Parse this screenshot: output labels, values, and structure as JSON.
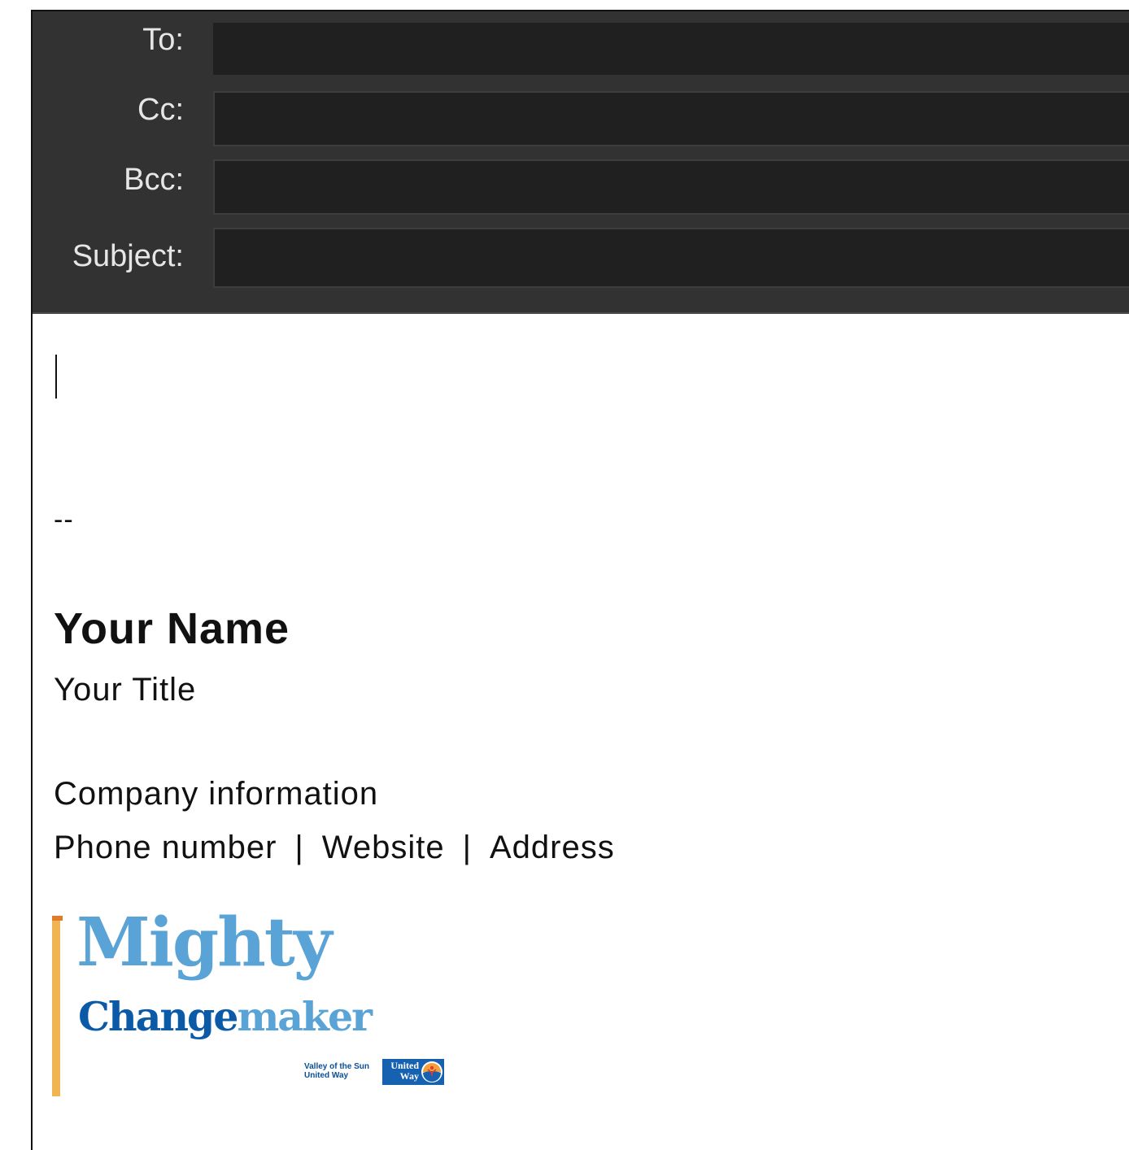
{
  "header": {
    "fields": [
      {
        "label": "To:",
        "value": ""
      },
      {
        "label": "Cc:",
        "value": ""
      },
      {
        "label": "Bcc:",
        "value": ""
      },
      {
        "label": "Subject:",
        "value": ""
      }
    ]
  },
  "body": {
    "separator": "--",
    "signature": {
      "name": "Your Name",
      "title": "Your Title",
      "company": "Company information",
      "contact": [
        "Phone number",
        "Website",
        "Address"
      ],
      "divider": "|"
    }
  },
  "logo": {
    "line1": "Mighty",
    "line2_dark": "Change",
    "line2_light": "maker",
    "org_line1": "Valley of the Sun",
    "org_line2": "United Way",
    "badge_line1": "United",
    "badge_line2": "Way",
    "colors": {
      "light_blue": "#5aa3d6",
      "dark_blue": "#0a5aa8",
      "accent_bar": "#f1b452"
    }
  }
}
